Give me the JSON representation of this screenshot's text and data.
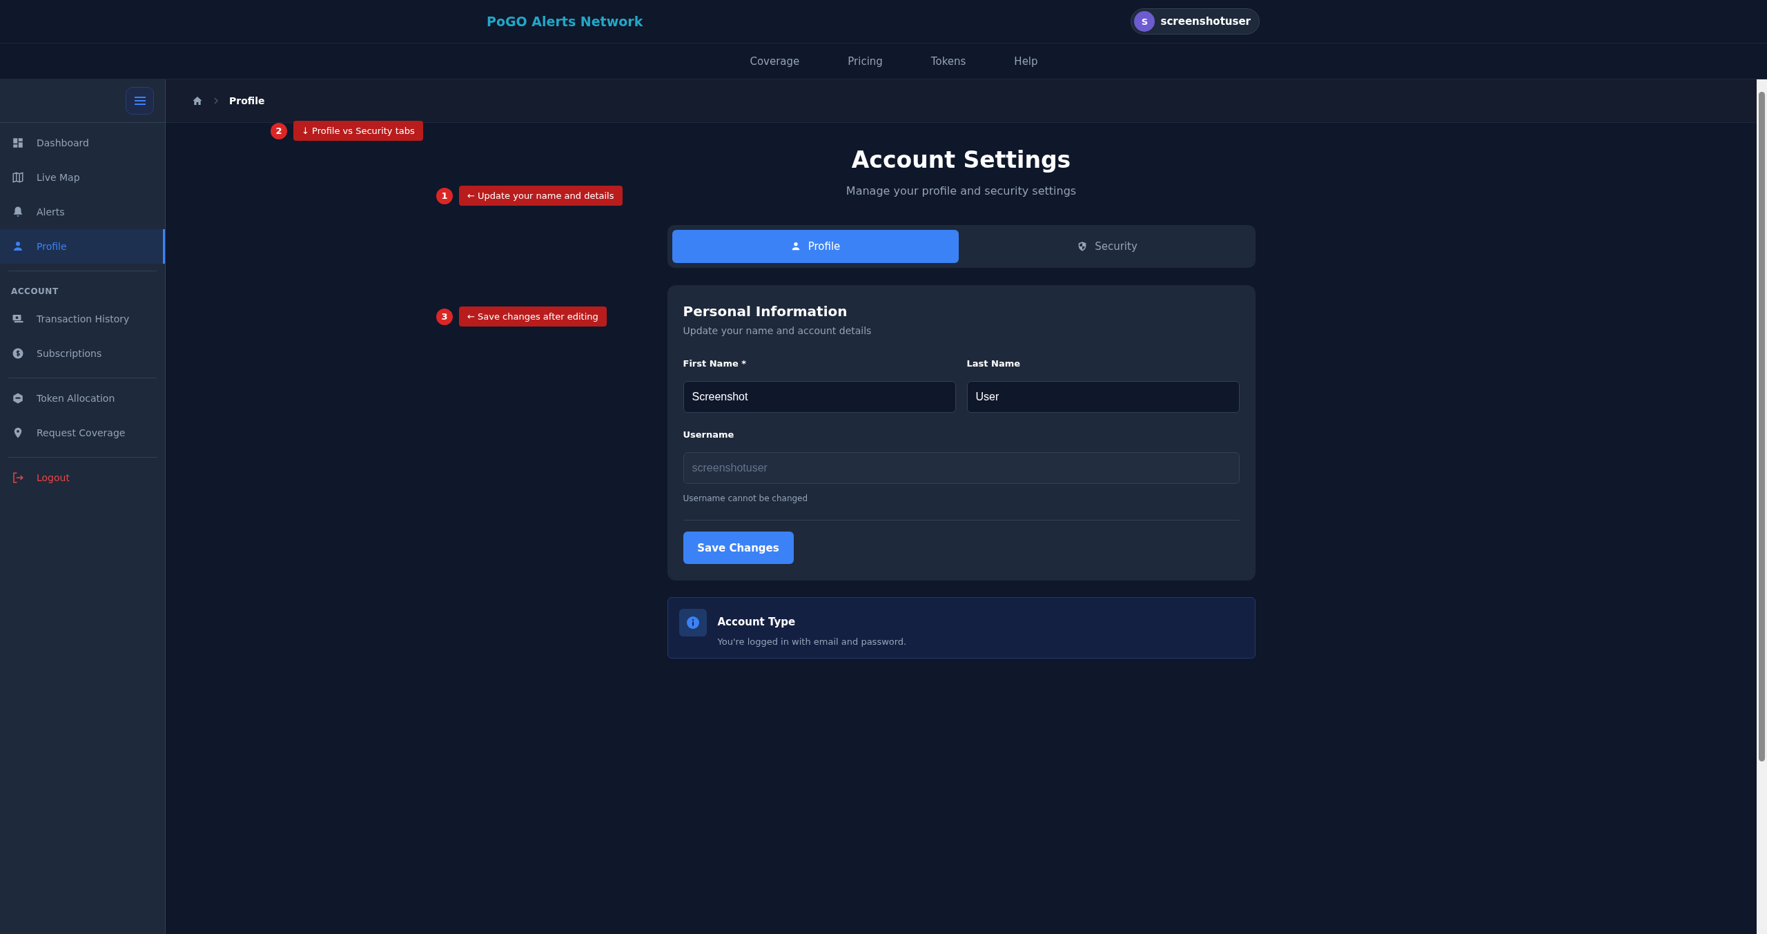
{
  "header": {
    "brand": "PoGO Alerts Network",
    "user": {
      "initial": "S",
      "name": "screenshotuser"
    }
  },
  "nav": [
    "Coverage",
    "Pricing",
    "Tokens",
    "Help"
  ],
  "sidebar": {
    "groups": [
      {
        "items": [
          {
            "label": "Dashboard",
            "kind": "normal",
            "selected": false
          },
          {
            "label": "Live Map",
            "kind": "normal",
            "selected": false
          },
          {
            "label": "Alerts",
            "kind": "normal",
            "selected": false
          },
          {
            "label": "Profile",
            "kind": "normal",
            "selected": true
          }
        ]
      },
      {
        "heading": "ACCOUNT",
        "items": [
          {
            "label": "Transaction History",
            "kind": "normal",
            "selected": false
          },
          {
            "label": "Subscriptions",
            "kind": "normal",
            "selected": false
          }
        ]
      },
      {
        "items": [
          {
            "label": "Token Allocation",
            "kind": "normal",
            "selected": false
          },
          {
            "label": "Request Coverage",
            "kind": "normal",
            "selected": false
          }
        ]
      },
      {
        "items": [
          {
            "label": "Logout",
            "kind": "danger",
            "selected": false
          }
        ]
      }
    ]
  },
  "breadcrumb": {
    "current": "Profile"
  },
  "annotations": [
    {
      "number": "2",
      "text": "↓ Profile vs Security tabs"
    },
    {
      "number": "1",
      "text": "← Update your name and details"
    },
    {
      "number": "3",
      "text": "← Save changes after editing"
    }
  ],
  "page": {
    "title": "Account Settings",
    "subtitle": "Manage your profile and security settings"
  },
  "tabs": [
    {
      "label": "Profile",
      "selected": true
    },
    {
      "label": "Security",
      "selected": false
    }
  ],
  "card": {
    "title": "Personal Information",
    "subtitle": "Update your name and account details",
    "fields": [
      {
        "label": "First Name *",
        "value": "Screenshot",
        "disabled": false
      },
      {
        "label": "Last Name",
        "value": "User",
        "disabled": false
      },
      {
        "label": "Username",
        "value": "screenshotuser",
        "disabled": true
      }
    ],
    "hint": "Username cannot be changed",
    "button": "Save Changes"
  },
  "info": {
    "title": "Account Type",
    "text": "You're logged in with email and password."
  }
}
